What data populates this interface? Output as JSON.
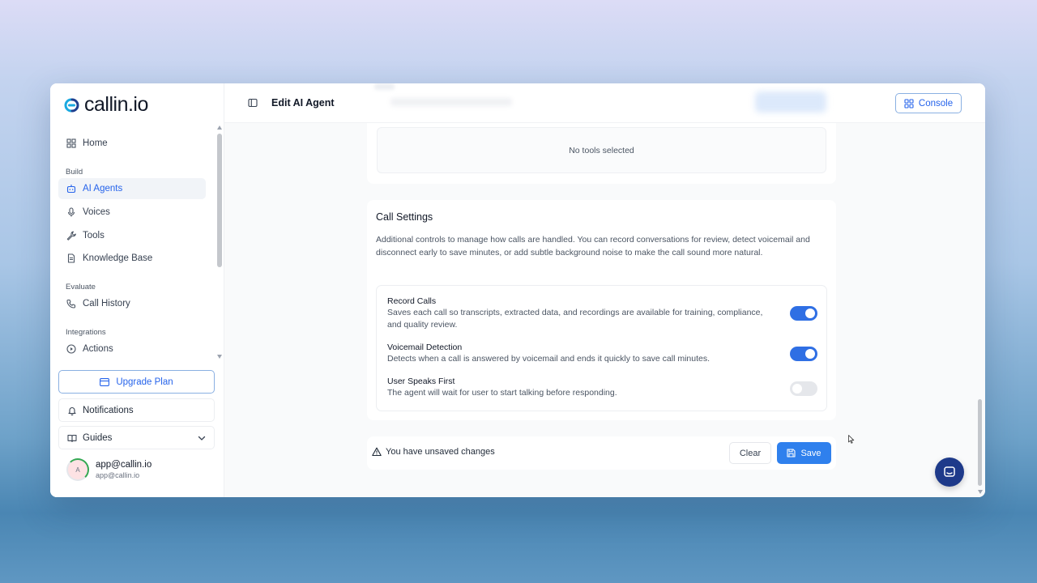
{
  "brand": {
    "name": "callin.io",
    "accent": "#2563eb",
    "logo_icon": "callin-logo-icon"
  },
  "sidebar": {
    "home": {
      "label": "Home",
      "icon": "grid-icon"
    },
    "sections": {
      "build": "Build",
      "evaluate": "Evaluate",
      "integrations": "Integrations"
    },
    "items": [
      {
        "label": "AI Agents",
        "icon": "bot-icon",
        "active": true
      },
      {
        "label": "Voices",
        "icon": "microphone-icon"
      },
      {
        "label": "Tools",
        "icon": "wrench-icon"
      },
      {
        "label": "Knowledge Base",
        "icon": "document-icon"
      },
      {
        "label": "Call History",
        "icon": "phone-icon"
      },
      {
        "label": "Actions",
        "icon": "play-circle-icon"
      }
    ],
    "upgrade_label": "Upgrade Plan",
    "notifications_label": "Notifications",
    "guides_label": "Guides",
    "user": {
      "avatar_initial": "A",
      "name": "app@callin.io",
      "email": "app@callin.io"
    }
  },
  "header": {
    "title": "Edit AI Agent",
    "console_label": "Console"
  },
  "tools": {
    "empty_text": "No tools selected"
  },
  "call_settings": {
    "title": "Call Settings",
    "description": "Additional controls to manage how calls are handled. You can record conversations for review, detect voicemail and disconnect early to save minutes, or add subtle background noise to make the call sound more natural.",
    "options": [
      {
        "title": "Record Calls",
        "description": "Saves each call so transcripts, extracted data, and recordings are available for training, compliance, and quality review.",
        "enabled": true
      },
      {
        "title": "Voicemail Detection",
        "description": "Detects when a call is answered by voicemail and ends it quickly to save call minutes.",
        "enabled": true
      },
      {
        "title": "User Speaks First",
        "description": "The agent will wait for user to start talking before responding.",
        "enabled": false
      }
    ]
  },
  "save_bar": {
    "message": "You have unsaved changes",
    "clear_label": "Clear",
    "save_label": "Save"
  },
  "colors": {
    "primary_button": "#2f80ed",
    "toggle_on": "#2f6fe4",
    "chat_button": "#1e3a8a"
  }
}
